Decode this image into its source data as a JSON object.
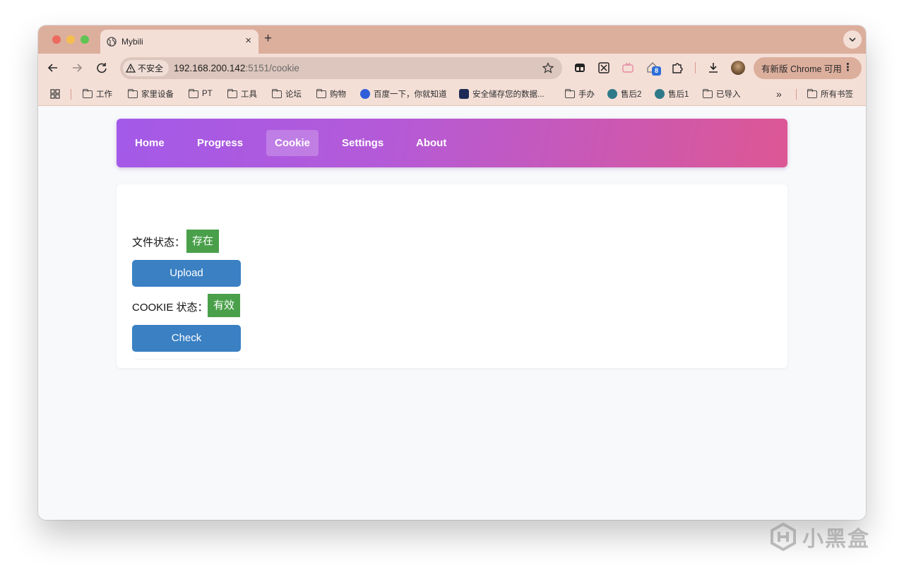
{
  "browser": {
    "tab": {
      "title": "Mybili",
      "close": "×"
    },
    "new_tab": "+",
    "address": {
      "security_label": "不安全",
      "url_host": "192.168.200.142",
      "url_rest": ":5151/cookie"
    },
    "update_button": "有新版 Chrome 可用",
    "update_menu": "⋮",
    "extension_badge": "8",
    "bookmarks": {
      "apps_icon": "apps-grid-icon",
      "items": [
        "工作",
        "家里设备",
        "PT",
        "工具",
        "论坛",
        "购物",
        "百度一下，你就知道",
        "安全储存您的数据...",
        "手办",
        "售后2",
        "售后1",
        "已导入"
      ],
      "overflow": "»",
      "all_bookmarks": "所有书签"
    }
  },
  "app": {
    "nav": [
      "Home",
      "Progress",
      "Cookie",
      "Settings",
      "About"
    ],
    "active_nav": "Cookie",
    "gradient": {
      "start": "#a35ae8",
      "end": "#dd5794"
    },
    "file_status": {
      "label": "文件状态：",
      "value": "存在",
      "color": "#4aa04a"
    },
    "upload_button": "Upload",
    "cookie_status": {
      "label": "COOKIE 状态：",
      "value": "有效",
      "color": "#4aa04a"
    },
    "check_button": "Check",
    "button_color": "#3a80c3"
  },
  "watermark": {
    "text": "小黑盒"
  }
}
